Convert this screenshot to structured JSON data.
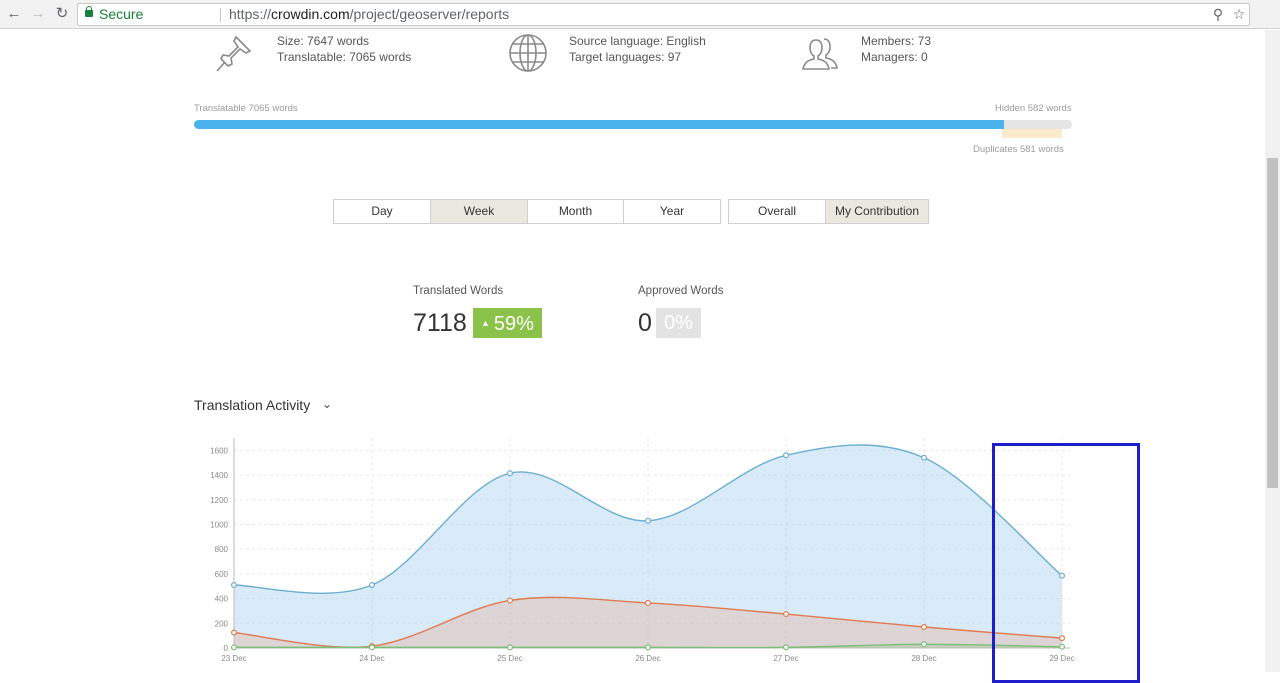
{
  "browser": {
    "secure_label": "Secure",
    "url_scheme": "https://",
    "url_host": "crowdin.com",
    "url_path": "/project/geoserver/reports"
  },
  "stats": {
    "size": "Size: 7647 words",
    "translatable": "Translatable: 7065 words",
    "source_language": "Source language: English",
    "target_languages": "Target languages: 97",
    "members": "Members: 73",
    "managers": "Managers: 0"
  },
  "progress": {
    "translatable_label": "Translatable 7065 words",
    "hidden_label": "Hidden 582 words",
    "duplicates_label": "Duplicates 581 words",
    "translatable_fraction": 0.923
  },
  "period_tabs": [
    {
      "label": "Day",
      "active": false
    },
    {
      "label": "Week",
      "active": true
    },
    {
      "label": "Month",
      "active": false
    },
    {
      "label": "Year",
      "active": false
    }
  ],
  "scope_tabs": [
    {
      "label": "Overall",
      "active": false
    },
    {
      "label": "My Contribution",
      "active": true
    }
  ],
  "kpis": {
    "translated_label": "Translated Words",
    "translated_value": "7118",
    "translated_change": "59%",
    "approved_label": "Approved Words",
    "approved_value": "0",
    "approved_change": "0%"
  },
  "activity": {
    "title": "Translation Activity"
  },
  "colors": {
    "accent_blue": "#4ab3ec",
    "badge_green": "#8bc34a",
    "series_translated": "#6aaed0",
    "series_approved": "#e07a50",
    "series_third": "#7bbf76",
    "highlight_box": "#1e1ecd"
  },
  "chart_data": {
    "type": "area",
    "title": "",
    "xlabel": "",
    "ylabel": "",
    "categories": [
      "23 Dec",
      "24 Dec",
      "25 Dec",
      "26 Dec",
      "27 Dec",
      "28 Dec",
      "29 Dec"
    ],
    "yticks": [
      0,
      200,
      400,
      600,
      800,
      1000,
      1200,
      1400,
      1600
    ],
    "ylim": [
      0,
      1700
    ],
    "grid": true,
    "legend": "none",
    "series": [
      {
        "values": [
          510,
          510,
          1415,
          1030,
          1560,
          1540,
          585
        ]
      },
      {
        "values": [
          125,
          15,
          385,
          365,
          275,
          170,
          80
        ]
      },
      {
        "values": [
          5,
          5,
          5,
          5,
          5,
          30,
          10
        ]
      }
    ]
  }
}
